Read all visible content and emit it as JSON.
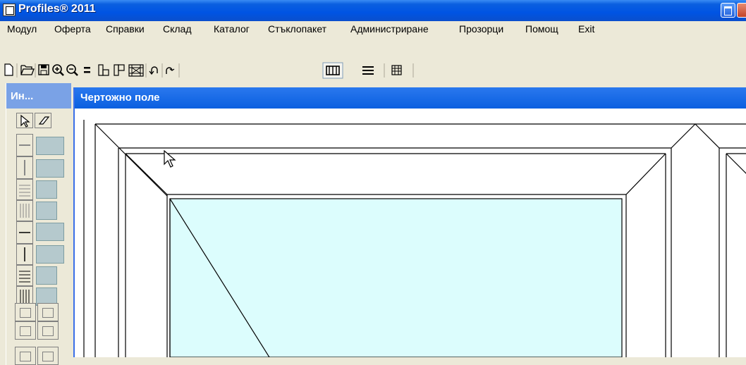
{
  "app": {
    "title": "Profiles® 2011"
  },
  "menu": {
    "items": [
      "Модул",
      "Оферта",
      "Справки",
      "Склад",
      "Каталог",
      "Стъклопакет",
      "Администриране",
      "Прозорци",
      "Помощ",
      "Exit"
    ]
  },
  "toolbar": {
    "buttons": [
      "new-icon",
      "open-icon",
      "save-icon",
      "zoom-in-icon",
      "zoom-out-icon",
      "equal-icon",
      "frame-left-icon",
      "frame-right-icon",
      "grid-icon",
      "undo-icon",
      "redo-icon",
      "book-icon",
      "lines-icon",
      "table-icon"
    ],
    "equal_glyph": "="
  },
  "tool_panel": {
    "title": "Ин..."
  },
  "drawing": {
    "title": "Чертожно поле",
    "glass_color": "#dcfdfd",
    "frame_color": "#000000"
  }
}
